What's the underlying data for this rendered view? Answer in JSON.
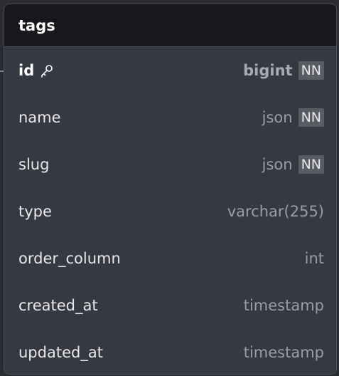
{
  "table": {
    "name": "tags",
    "columns": [
      {
        "name": "id",
        "type": "bigint",
        "constraint": "NN",
        "primary_key": true,
        "icon": "key-icon"
      },
      {
        "name": "name",
        "type": "json",
        "constraint": "NN"
      },
      {
        "name": "slug",
        "type": "json",
        "constraint": "NN"
      },
      {
        "name": "type",
        "type": "varchar(255)",
        "constraint": ""
      },
      {
        "name": "order_column",
        "type": "int",
        "constraint": ""
      },
      {
        "name": "created_at",
        "type": "timestamp",
        "constraint": ""
      },
      {
        "name": "updated_at",
        "type": "timestamp",
        "constraint": ""
      }
    ]
  },
  "colors": {
    "header_bg": "#17181b",
    "body_bg": "#373942",
    "badge_bg": "#5a5c64",
    "type_text": "#9a9ca5"
  }
}
